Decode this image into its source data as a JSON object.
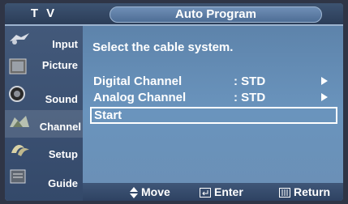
{
  "header": {
    "tv_label": "T V",
    "title": "Auto Program"
  },
  "sidebar": {
    "items": [
      {
        "label": "Input",
        "icon": "input-icon"
      },
      {
        "label": "Picture",
        "icon": "picture-icon"
      },
      {
        "label": "Sound",
        "icon": "sound-icon"
      },
      {
        "label": "Channel",
        "icon": "channel-icon",
        "active": true
      },
      {
        "label": "Setup",
        "icon": "setup-icon"
      },
      {
        "label": "Guide",
        "icon": "guide-icon"
      }
    ]
  },
  "main": {
    "prompt": "Select the cable system.",
    "options": [
      {
        "name": "Digital Channel",
        "value": ": STD"
      },
      {
        "name": "Analog Channel",
        "value": ": STD"
      },
      {
        "name": "Start",
        "value": ""
      }
    ]
  },
  "footer": {
    "move": "Move",
    "enter": "Enter",
    "return": "Return"
  }
}
